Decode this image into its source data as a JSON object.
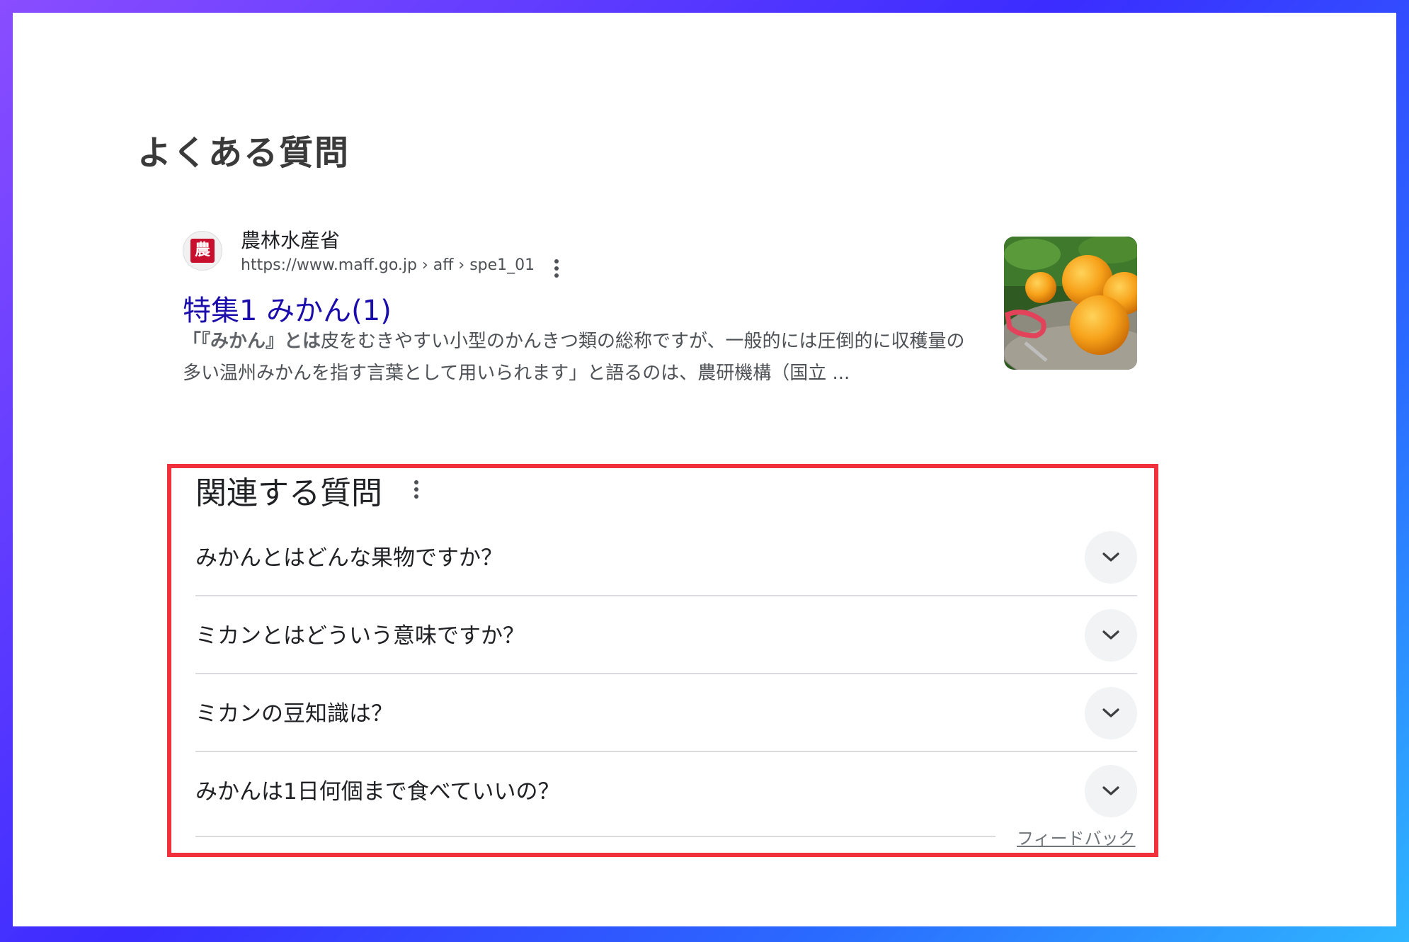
{
  "faq": {
    "heading": "よくある質問"
  },
  "result": {
    "site_name": "農林水産省",
    "url": "https://www.maff.go.jp › aff › spe1_01",
    "favicon_char": "農",
    "title": "特集1 みかん(1)",
    "snippet_bold": "「『みかん』とは",
    "snippet_rest": "皮をむきやすい小型のかんきつ類の総称ですが、一般的には圧倒的に収穫量の多い温州みかんを指す言葉として用いられます」と語るのは、農研機構（国立 ..."
  },
  "paa": {
    "title": "関連する質問",
    "questions": [
      "みかんとはどんな果物ですか？",
      "ミカンとはどういう意味ですか？",
      "ミカンの豆知識は？",
      "みかんは1日何個まで食べていいの？"
    ],
    "feedback": "フィードバック"
  },
  "colors": {
    "link": "#1a0dab",
    "highlight_border": "#f0303a",
    "favicon_bg": "#c8102e"
  },
  "icons": [
    "more-vert-icon",
    "chevron-down-icon"
  ]
}
